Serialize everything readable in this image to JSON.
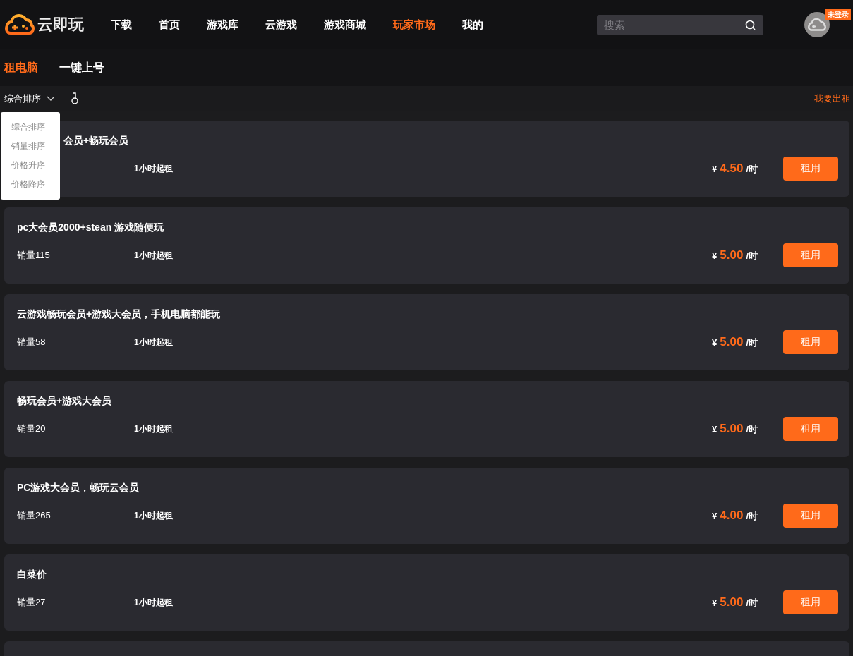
{
  "header": {
    "logo_text": "云即玩",
    "nav": [
      {
        "label": "下载",
        "selected": false
      },
      {
        "label": "首页",
        "selected": false
      },
      {
        "label": "游戏库",
        "selected": false
      },
      {
        "label": "云游戏",
        "selected": false
      },
      {
        "label": "游戏商城",
        "selected": false
      },
      {
        "label": "玩家市场",
        "selected": true
      },
      {
        "label": "我的",
        "selected": false
      }
    ],
    "search": {
      "placeholder": "搜索"
    },
    "login_badge": "未登录"
  },
  "subnav": [
    {
      "label": "租电脑",
      "selected": true
    },
    {
      "label": "一键上号",
      "selected": false
    }
  ],
  "toolbar": {
    "sort_label": "综合排序",
    "rent_out_link": "我要出租"
  },
  "sort_menu": {
    "expanded": true,
    "options": [
      "综合排序",
      "销量排序",
      "价格升序",
      "价格降序"
    ]
  },
  "listings": [
    {
      "title": "会员+畅玩会员",
      "partly_covered": true,
      "rental_term": "1小时起租",
      "currency": "¥",
      "price": "4.50",
      "unit": "/时",
      "button": "租用"
    },
    {
      "title": "pc大会员2000+stean 游戏随便玩",
      "sales": "销量115",
      "rental_term": "1小时起租",
      "currency": "¥",
      "price": "5.00",
      "unit": "/时",
      "button": "租用"
    },
    {
      "title": "云游戏畅玩会员+游戏大会员，手机电脑都能玩",
      "sales": "销量58",
      "rental_term": "1小时起租",
      "currency": "¥",
      "price": "5.00",
      "unit": "/时",
      "button": "租用"
    },
    {
      "title": "畅玩会员+游戏大会员",
      "sales": "销量20",
      "rental_term": "1小时起租",
      "currency": "¥",
      "price": "5.00",
      "unit": "/时",
      "button": "租用"
    },
    {
      "title": "PC游戏大会员，畅玩云会员",
      "sales": "销量265",
      "rental_term": "1小时起租",
      "currency": "¥",
      "price": "4.00",
      "unit": "/时",
      "button": "租用"
    },
    {
      "title": "白菜价",
      "sales": "销量27",
      "rental_term": "1小时起租",
      "currency": "¥",
      "price": "5.00",
      "unit": "/时",
      "button": "租用"
    }
  ]
}
